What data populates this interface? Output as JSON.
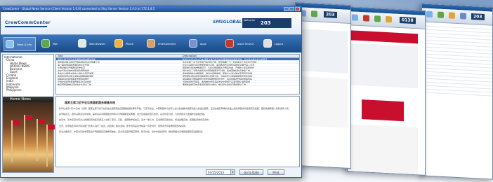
{
  "main": {
    "title": "CrewComm - Global News Service (Client Version 1.0.0) connected to Ship Server Version 1.0.0 at 172.1.8.5",
    "brand": "CrewCommCenter",
    "partner": "SMSGLOBAL",
    "login_number": "203",
    "login_label": "Welcome",
    "nav": [
      {
        "label": "News & Info"
      },
      {
        "label": "Mail"
      },
      {
        "label": "Web Browser"
      },
      {
        "label": "Phone"
      },
      {
        "label": "Entertainment"
      },
      {
        "label": "Apps"
      },
      {
        "label": "Leave Service"
      },
      {
        "label": "Logout"
      }
    ],
    "tree": [
      "International",
      "China",
      "Home News",
      "WORLD NEWS",
      "Business",
      "Sport",
      "Croatia",
      "England",
      "India",
      "Indonesia",
      "Malaysia",
      "Philippines"
    ],
    "home_news_label": "Home News",
    "grid": {
      "col_title": "Title",
      "col_desc": "Description",
      "rows": [
        {
          "title": "国家主席习近平会见美国前国务卿基辛格",
          "desc": "新华社北京7月25日电 国家主席习近平会见美国前国务卿基辛格，双方就中美关系交换意见"
        },
        {
          "title": "国务院总理主持召开国务院常务会议部署工作",
          "desc": "会议听取了关于经济运行情况的汇报，研究部署了下一阶段重点工作任务与安排"
        },
        {
          "title": "第一届中国品牌发展高峰论坛开幕",
          "desc": "论坛以品牌引领高质量发展为主题，来自各界代表围绕品牌建设展开深入交流"
        },
        {
          "title": "全国夏粮总产量再创历史新高",
          "desc": "国家统计局发布数据显示，今年全国夏粮生产再获丰收，产量较上年有所增长"
        },
        {
          "title": "中央气象台发布暴雨蓝色预警信号",
          "desc": "预计未来三天南方地区将出现强降雨天气过程，各地需做好防汛准备工作"
        },
        {
          "title": "多地出台措施支持中小微企业稳定发展",
          "desc": "各地相继推出减税降费、融资支持等举措，帮助企业渡过难关实现稳定发展"
        },
        {
          "title": "我国科学家在量子通信领域取得新突破",
          "desc": "研究团队成功实现远距离量子密钥分发，为构建安全通信网络奠定坚实基础"
        },
        {
          "title": "铁路暑运启动旅客发送量持续攀升",
          "desc": "暑运期间全国铁路预计发送旅客数量同比增长，多条线路增开临时旅客列车"
        },
        {
          "title": "全国文化和旅游消费季系列活动启动",
          "desc": "活动将持续至年底，各地推出丰富多彩的文化旅游产品满足群众消费需求"
        },
        {
          "title": "教育部部署做好高校毕业生就业工作",
          "desc": "要求各地各高校多渠道拓展就业岗位，做好就业指导与服务帮扶工作"
        }
      ]
    },
    "article": {
      "headline": "国家主席习近平会见美国前国务卿基辛格",
      "paragraphs": [
        "新华社北京7月25日电（记者）国家主席习近平在钓鱼台国宾馆会见美国前国务卿基辛格。习近平指出，中美两国作为世界上最大的发展中国家和最大的发达国家，应当在相互尊重的基础上推动两国关系健康稳定发展，更好造福两国人民和世界人民。",
        "基辛格表示，很高兴再次访问中国，美中关系对两国和世界和平与繁荣都至关重要。双方应加强对话与合作，妥善管控分歧，为世界和平与发展作出积极贡献。",
        "会见中，双方还就共同关心的国际和地区问题深入交换了意见。王毅、秦刚等参加会见。双方一致认为，应当保持高层交往，增进战略互信，拓展各领域务实合作。",
        "当天，基辛格还同中方有关部门负责人进行了会谈，并出席了相关活动。此次访问是基辛格第一百次访华，受到中方高度重视和热情接待。",
        "有关方面表示，中美关系的未来取决于两国能否正确看待彼此，双方应当坚持相互尊重、和平共处、合作共赢的原则，推动两国关系重回健康稳定发展轨道。"
      ]
    },
    "date_value": "07/25/2013",
    "go_label": "Go to Date",
    "print_label": "Print"
  },
  "back_windows": {
    "w1_value": "203",
    "w2_value": "0138",
    "w3_value": "203"
  }
}
